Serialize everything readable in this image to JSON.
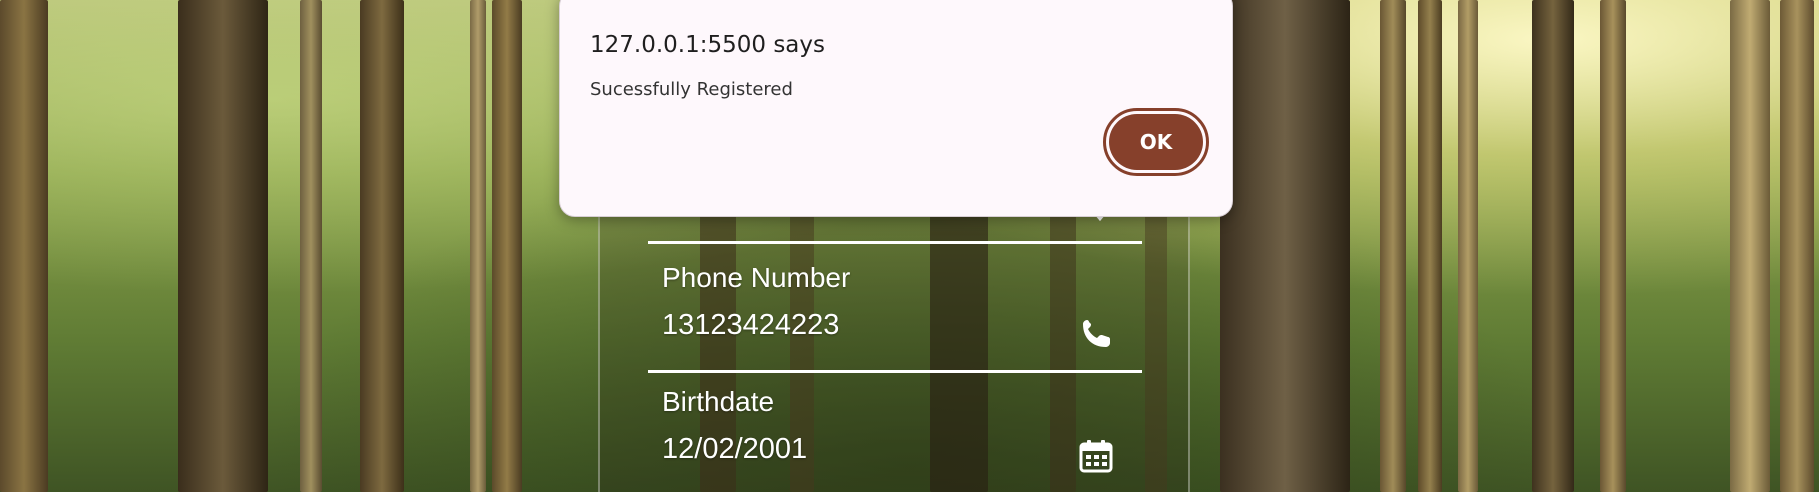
{
  "dialog": {
    "title": "127.0.0.1:5500 says",
    "message": "Sucessfully Registered",
    "ok_label": "OK",
    "accent_color": "#86402b"
  },
  "form": {
    "fields": [
      {
        "label": "Phone Number",
        "value": "13123424223",
        "icon": "phone-icon"
      },
      {
        "label": "Birthdate",
        "value": "12/02/2001",
        "icon": "calendar-icon"
      }
    ]
  },
  "background": {
    "description_icon": "forest-background"
  }
}
